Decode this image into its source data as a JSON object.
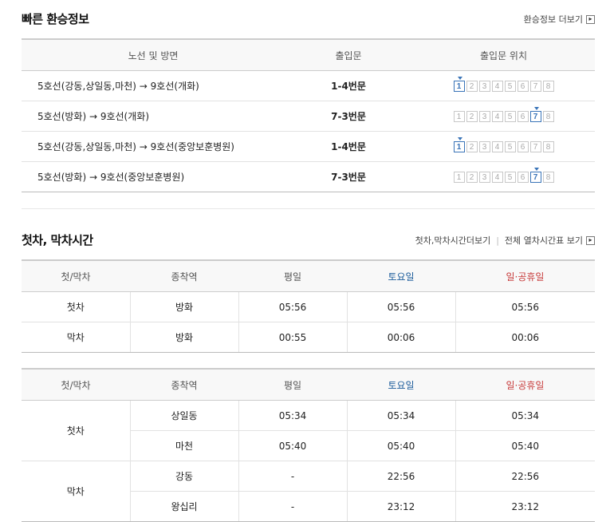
{
  "transfer": {
    "title": "빠른 환승정보",
    "more_label": "환승정보 더보기",
    "headers": [
      "노선 및 방면",
      "출입문",
      "출입문 위치"
    ],
    "door_numbers": [
      "1",
      "2",
      "3",
      "4",
      "5",
      "6",
      "7",
      "8"
    ],
    "rows": [
      {
        "route": "5호선(강동,상일동,마천) → 9호선(개화)",
        "exit": "1-4번문",
        "door": 1
      },
      {
        "route": "5호선(방화) → 9호선(개화)",
        "exit": "7-3번문",
        "door": 7
      },
      {
        "route": "5호선(강동,상일동,마천) → 9호선(중앙보훈병원)",
        "exit": "1-4번문",
        "door": 1
      },
      {
        "route": "5호선(방화) → 9호선(중앙보훈병원)",
        "exit": "7-3번문",
        "door": 7
      }
    ]
  },
  "firstlast": {
    "title": "첫차, 막차시간",
    "more_label": "첫차,막차시간더보기",
    "all_label": "전체 열차시간표 보기",
    "headers": [
      "첫/막차",
      "종착역",
      "평일",
      "토요일",
      "일·공휴일"
    ],
    "table1": [
      {
        "kind": "첫차",
        "station": "방화",
        "weekday": "05:56",
        "saturday": "05:56",
        "holiday": "05:56"
      },
      {
        "kind": "막차",
        "station": "방화",
        "weekday": "00:55",
        "saturday": "00:06",
        "holiday": "00:06"
      }
    ],
    "table2": [
      {
        "kind": "첫차",
        "station": "상일동",
        "weekday": "05:34",
        "saturday": "05:34",
        "holiday": "05:34"
      },
      {
        "kind": "첫차",
        "station": "마천",
        "weekday": "05:40",
        "saturday": "05:40",
        "holiday": "05:40"
      },
      {
        "kind": "막차",
        "station": "강동",
        "weekday": "-",
        "saturday": "22:56",
        "holiday": "22:56"
      },
      {
        "kind": "막차",
        "station": "왕십리",
        "weekday": "-",
        "saturday": "23:12",
        "holiday": "23:12"
      }
    ]
  }
}
